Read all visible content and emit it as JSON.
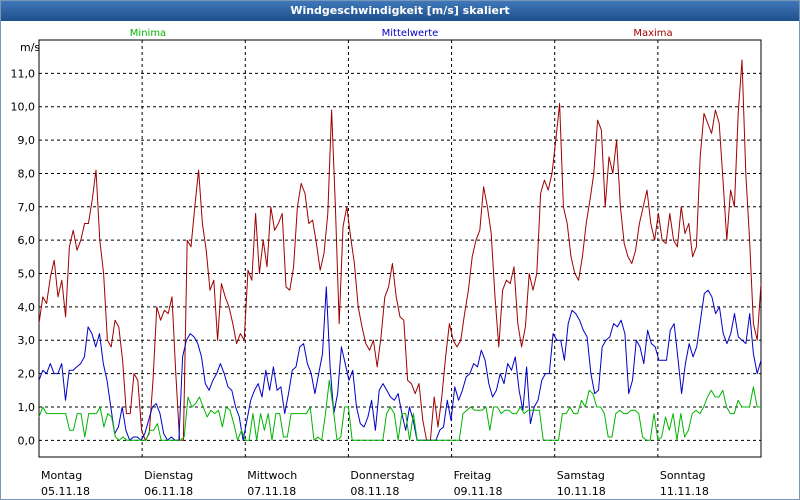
{
  "window": {
    "title": "Windgeschwindigkeit [m/s] skaliert"
  },
  "legend": {
    "minima": "Minima",
    "mittelwerte": "Mittelwerte",
    "maxima": "Maxima"
  },
  "colors": {
    "minima": "#00b400",
    "mittelwerte": "#0000c8",
    "maxima": "#a00000",
    "grid": "#000000",
    "title_bar": "#2a5c9a"
  },
  "chart_data": {
    "type": "line",
    "title": "Windgeschwindigkeit [m/s] skaliert",
    "ylabel": "m/s",
    "ylim": [
      -0.5,
      12.0
    ],
    "yticks": [
      0,
      1,
      2,
      3,
      4,
      5,
      6,
      7,
      8,
      9,
      10,
      11
    ],
    "ytick_labels": [
      "0,0",
      "1,0",
      "2,0",
      "3,0",
      "4,0",
      "5,0",
      "6,0",
      "7,0",
      "8,0",
      "9,0",
      "10,0",
      "11,0"
    ],
    "xlim": [
      0,
      7
    ],
    "x_step_days": 0.04167,
    "grid": true,
    "legend_position": "top",
    "day_labels": [
      {
        "day": "Montag",
        "date": "05.11.18"
      },
      {
        "day": "Dienstag",
        "date": "06.11.18"
      },
      {
        "day": "Mittwoch",
        "date": "07.11.18"
      },
      {
        "day": "Donnerstag",
        "date": "08.11.18"
      },
      {
        "day": "Freitag",
        "date": "09.11.18"
      },
      {
        "day": "Samstag",
        "date": "10.11.18"
      },
      {
        "day": "Sonntag",
        "date": "11.11.18"
      }
    ],
    "series": [
      {
        "name": "Maxima",
        "values": [
          3.5,
          4.3,
          4.1,
          4.9,
          5.4,
          4.3,
          4.8,
          3.7,
          5.8,
          6.3,
          5.7,
          6.0,
          6.5,
          6.5,
          7.2,
          8.1,
          6.0,
          5.0,
          3.0,
          2.8,
          3.6,
          3.4,
          2.4,
          0.8,
          0.8,
          2.0,
          1.8,
          0.3,
          0.0,
          0.2,
          1.8,
          4.0,
          3.6,
          3.9,
          3.8,
          4.3,
          2.0,
          0.0,
          0.0,
          6.0,
          5.8,
          7.0,
          8.1,
          6.5,
          5.7,
          4.5,
          4.8,
          3.0,
          4.7,
          4.3,
          4.0,
          3.5,
          2.9,
          3.2,
          3.0,
          5.1,
          4.8,
          6.8,
          5.0,
          6.0,
          5.2,
          7.0,
          6.3,
          6.5,
          6.8,
          4.6,
          4.5,
          5.2,
          7.0,
          7.7,
          7.4,
          6.5,
          6.6,
          5.9,
          5.1,
          5.6,
          6.8,
          9.9,
          7.0,
          3.5,
          6.4,
          7.0,
          6.1,
          5.3,
          4.0,
          3.4,
          2.9,
          2.7,
          3.0,
          2.2,
          3.1,
          4.3,
          4.6,
          5.3,
          4.3,
          3.7,
          3.6,
          1.8,
          1.7,
          1.4,
          1.7,
          0.6,
          0.0,
          0.0,
          1.3,
          0.4,
          1.3,
          2.5,
          3.5,
          3.0,
          2.8,
          3.0,
          3.8,
          4.5,
          5.5,
          6.0,
          6.3,
          7.6,
          7.0,
          6.2,
          4.3,
          2.8,
          4.5,
          4.8,
          4.7,
          5.2,
          3.5,
          2.8,
          3.4,
          5.0,
          4.5,
          5.0,
          7.4,
          7.8,
          7.5,
          8.0,
          9.0,
          10.1,
          7.0,
          6.5,
          5.5,
          5.0,
          4.8,
          5.5,
          6.5,
          7.2,
          8.0,
          9.6,
          9.3,
          7.0,
          8.5,
          8.0,
          9.0,
          7.0,
          5.9,
          5.5,
          5.3,
          5.7,
          6.5,
          7.0,
          7.5,
          6.5,
          6.0,
          6.8,
          6.0,
          5.9,
          6.8,
          6.0,
          5.8,
          7.0,
          6.2,
          6.5,
          5.5,
          5.8,
          8.5,
          9.8,
          9.5,
          9.2,
          9.9,
          9.5,
          7.8,
          6.0,
          7.5,
          7.0,
          9.8,
          11.4,
          8.0,
          6.0,
          3.5,
          3.0,
          4.7
        ]
      },
      {
        "name": "Mittelwerte",
        "values": [
          1.8,
          2.1,
          2.0,
          2.3,
          2.0,
          2.0,
          2.3,
          1.2,
          2.1,
          2.1,
          2.2,
          2.3,
          2.5,
          3.4,
          3.2,
          2.8,
          3.2,
          2.3,
          1.8,
          1.0,
          0.2,
          0.4,
          1.0,
          0.3,
          0.0,
          0.1,
          0.1,
          0.0,
          0.2,
          0.6,
          1.0,
          1.1,
          0.8,
          0.2,
          0.0,
          0.1,
          0.0,
          0.0,
          2.5,
          3.0,
          3.2,
          3.1,
          2.9,
          2.5,
          1.7,
          1.5,
          1.8,
          2.0,
          2.3,
          2.0,
          1.6,
          1.5,
          1.0,
          0.7,
          0.0,
          0.6,
          1.2,
          1.5,
          1.7,
          1.3,
          2.1,
          1.5,
          2.2,
          1.5,
          1.6,
          0.8,
          1.4,
          2.1,
          2.2,
          2.8,
          2.9,
          2.3,
          2.0,
          1.4,
          2.0,
          2.6,
          4.6,
          2.2,
          0.8,
          1.4,
          2.8,
          2.3,
          1.8,
          2.1,
          1.0,
          0.5,
          0.4,
          0.7,
          1.2,
          0.3,
          1.5,
          1.7,
          1.5,
          1.3,
          1.2,
          1.4,
          0.8,
          0.3,
          1.0,
          0.6,
          0.0,
          0.0,
          0.0,
          0.0,
          0.0,
          0.0,
          0.3,
          0.4,
          1.2,
          0.6,
          1.6,
          1.2,
          1.5,
          1.9,
          2.0,
          2.3,
          2.2,
          2.7,
          2.4,
          1.7,
          1.3,
          1.5,
          2.0,
          1.7,
          2.3,
          2.1,
          2.5,
          1.5,
          0.9,
          2.2,
          0.5,
          1.0,
          1.2,
          1.8,
          2.0,
          2.0,
          3.2,
          3.0,
          3.0,
          2.4,
          3.5,
          3.9,
          3.8,
          3.6,
          3.3,
          3.1,
          2.0,
          1.4,
          1.5,
          2.8,
          3.0,
          3.1,
          3.5,
          3.4,
          3.6,
          3.2,
          1.4,
          1.8,
          3.0,
          2.8,
          2.3,
          3.3,
          2.9,
          2.8,
          2.4,
          2.4,
          2.4,
          3.3,
          3.5,
          2.5,
          1.4,
          2.3,
          2.9,
          2.5,
          2.8,
          3.6,
          4.4,
          4.5,
          4.3,
          3.8,
          4.0,
          3.2,
          2.9,
          3.2,
          3.8,
          3.1,
          3.0,
          2.9,
          3.8,
          2.6,
          2.0,
          2.4
        ]
      },
      {
        "name": "Minima",
        "values": [
          0.7,
          1.0,
          0.8,
          0.8,
          0.8,
          0.8,
          0.8,
          0.8,
          0.3,
          0.3,
          0.8,
          0.8,
          0.1,
          0.8,
          0.8,
          0.8,
          1.0,
          0.4,
          0.8,
          0.7,
          0.1,
          0.0,
          0.1,
          0.0,
          0.0,
          0.0,
          0.0,
          0.0,
          0.0,
          0.3,
          0.3,
          0.5,
          0.0,
          0.0,
          0.0,
          0.0,
          0.0,
          0.0,
          0.1,
          1.3,
          1.0,
          1.1,
          1.3,
          1.0,
          0.7,
          0.9,
          0.8,
          0.9,
          0.4,
          1.0,
          0.9,
          0.5,
          0.0,
          0.3,
          0.0,
          0.0,
          0.8,
          0.0,
          0.8,
          0.3,
          0.8,
          0.0,
          0.8,
          0.8,
          0.1,
          0.1,
          0.8,
          0.8,
          0.8,
          0.8,
          0.8,
          1.0,
          0.0,
          0.1,
          0.0,
          0.8,
          1.8,
          1.0,
          0.0,
          0.1,
          1.0,
          1.0,
          0.0,
          0.0,
          0.0,
          0.0,
          0.0,
          0.0,
          0.0,
          0.0,
          0.0,
          0.8,
          1.0,
          0.8,
          0.0,
          0.8,
          0.8,
          0.0,
          0.8,
          0.0,
          0.0,
          0.0,
          0.0,
          0.0,
          0.0,
          0.0,
          0.0,
          0.0,
          0.0,
          0.0,
          0.0,
          0.8,
          0.9,
          1.0,
          0.9,
          0.9,
          0.9,
          1.0,
          0.3,
          1.0,
          1.0,
          0.8,
          0.9,
          0.9,
          0.8,
          0.8,
          1.0,
          0.8,
          0.9,
          0.9,
          0.9,
          0.9,
          0.0,
          0.0,
          0.0,
          0.0,
          0.0,
          0.8,
          0.8,
          1.0,
          0.8,
          0.8,
          1.2,
          1.0,
          1.5,
          1.4,
          1.0,
          1.0,
          0.8,
          0.1,
          0.1,
          0.8,
          0.9,
          0.8,
          0.8,
          0.9,
          0.9,
          0.8,
          0.1,
          0.0,
          0.0,
          0.8,
          0.0,
          0.1,
          0.7,
          0.3,
          0.8,
          0.0,
          0.8,
          0.1,
          0.3,
          0.8,
          0.9,
          0.8,
          1.0,
          1.3,
          1.5,
          1.3,
          1.3,
          1.5,
          1.0,
          0.8,
          0.8,
          1.2,
          1.0,
          1.0,
          1.0,
          1.6,
          1.0,
          1.0
        ]
      }
    ]
  }
}
